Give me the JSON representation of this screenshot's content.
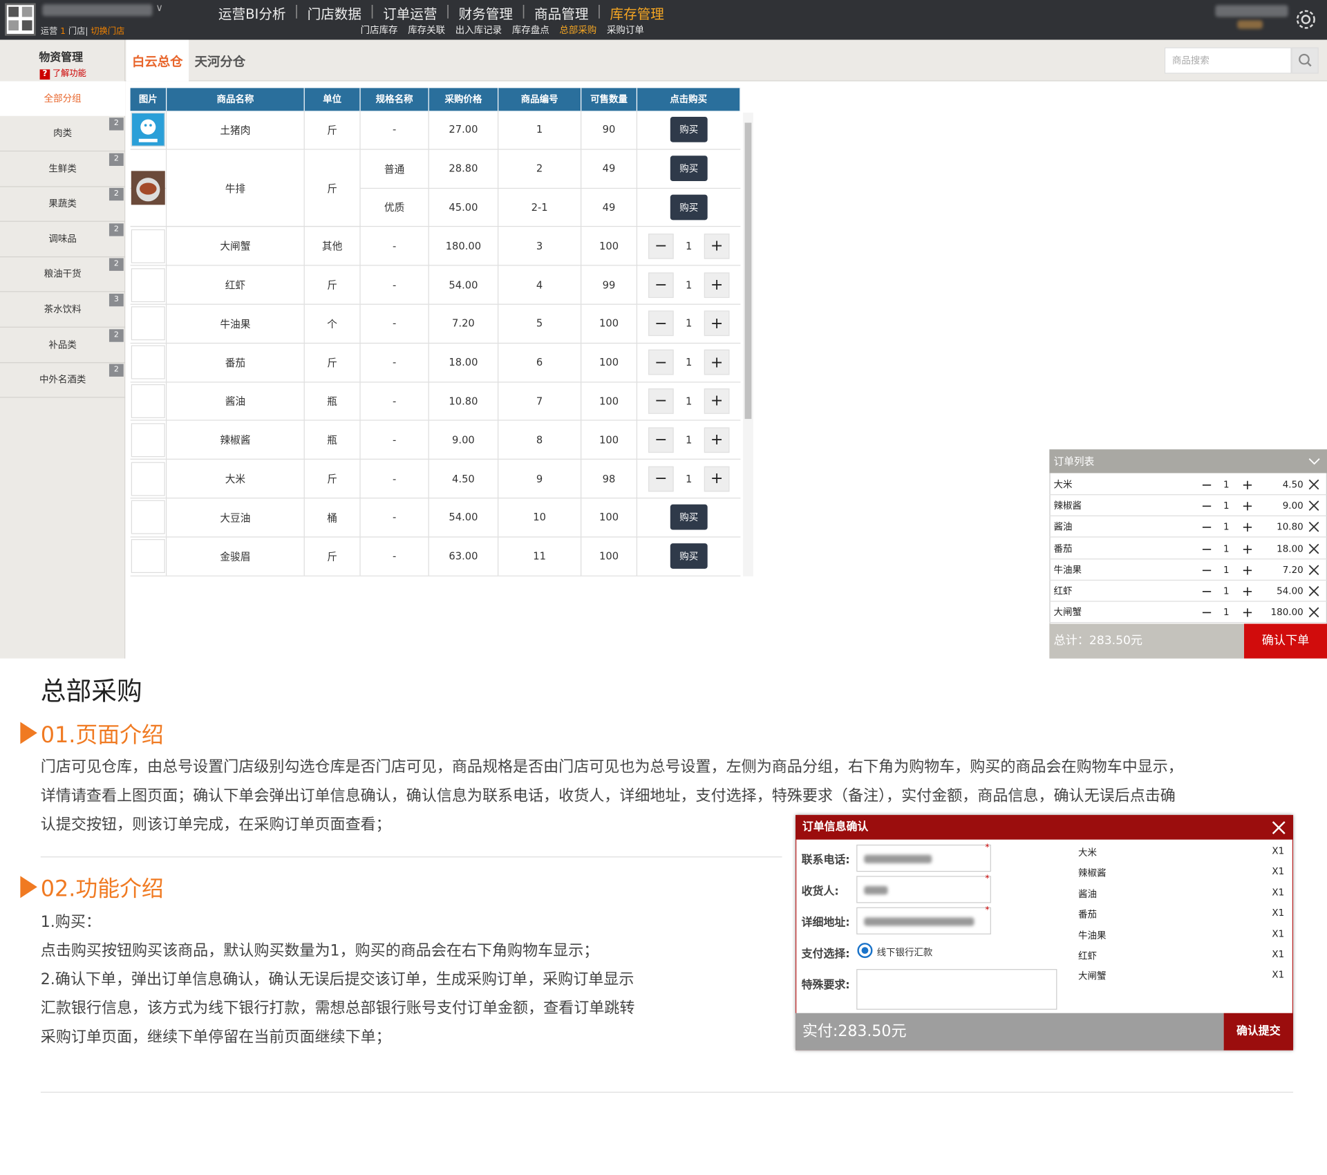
{
  "store": {
    "label_ops": "运营",
    "count": "1",
    "label_store": "门店",
    "switch": "切换门店"
  },
  "nav": {
    "main": [
      "运营BI分析",
      "门店数据",
      "订单运营",
      "财务管理",
      "商品管理",
      "库存管理"
    ],
    "sub": [
      "门店库存",
      "库存关联",
      "出入库记录",
      "库存盘点",
      "总部采购",
      "采购订单"
    ]
  },
  "header2": {
    "title": "物资管理",
    "help": "了解功能",
    "tab1": "白云总仓",
    "tab2": "天河分仓",
    "search_placeholder": "商品搜索"
  },
  "sidebar": {
    "all": "全部分组",
    "items": [
      {
        "label": "肉类",
        "count": "2"
      },
      {
        "label": "生鲜类",
        "count": "2"
      },
      {
        "label": "果蔬类",
        "count": "2"
      },
      {
        "label": "调味品",
        "count": "2"
      },
      {
        "label": "粮油干货",
        "count": "2"
      },
      {
        "label": "茶水饮料",
        "count": "3"
      },
      {
        "label": "补品类",
        "count": "2"
      },
      {
        "label": "中外名酒类",
        "count": "2"
      }
    ]
  },
  "table": {
    "headers": [
      "图片",
      "商品名称",
      "单位",
      "规格名称",
      "采购价格",
      "商品编号",
      "可售数量",
      "点击购买"
    ],
    "buy_label": "购买",
    "rows": [
      {
        "name": "土猪肉",
        "unit": "斤",
        "spec": "-",
        "price": "27.00",
        "code": "1",
        "stock": "90",
        "action": "buy"
      },
      {
        "name": "牛排",
        "unit": "斤",
        "spec": "普通",
        "price": "28.80",
        "code": "2",
        "stock": "49",
        "action": "buy"
      },
      {
        "name": "牛排",
        "unit": "斤",
        "spec": "优质",
        "price": "45.00",
        "code": "2-1",
        "stock": "49",
        "action": "buy"
      },
      {
        "name": "大闸蟹",
        "unit": "其他",
        "spec": "-",
        "price": "180.00",
        "code": "3",
        "stock": "100",
        "action": "qty",
        "qty": "1"
      },
      {
        "name": "红虾",
        "unit": "斤",
        "spec": "-",
        "price": "54.00",
        "code": "4",
        "stock": "99",
        "action": "qty",
        "qty": "1"
      },
      {
        "name": "牛油果",
        "unit": "个",
        "spec": "-",
        "price": "7.20",
        "code": "5",
        "stock": "100",
        "action": "qty",
        "qty": "1"
      },
      {
        "name": "番茄",
        "unit": "斤",
        "spec": "-",
        "price": "18.00",
        "code": "6",
        "stock": "100",
        "action": "qty",
        "qty": "1"
      },
      {
        "name": "酱油",
        "unit": "瓶",
        "spec": "-",
        "price": "10.80",
        "code": "7",
        "stock": "100",
        "action": "qty",
        "qty": "1"
      },
      {
        "name": "辣椒酱",
        "unit": "瓶",
        "spec": "-",
        "price": "9.00",
        "code": "8",
        "stock": "100",
        "action": "qty",
        "qty": "1"
      },
      {
        "name": "大米",
        "unit": "斤",
        "spec": "-",
        "price": "4.50",
        "code": "9",
        "stock": "98",
        "action": "qty",
        "qty": "1"
      },
      {
        "name": "大豆油",
        "unit": "桶",
        "spec": "-",
        "price": "54.00",
        "code": "10",
        "stock": "100",
        "action": "buy"
      },
      {
        "name": "金骏眉",
        "unit": "斤",
        "spec": "-",
        "price": "63.00",
        "code": "11",
        "stock": "100",
        "action": "buy"
      }
    ]
  },
  "order_list": {
    "title": "订单列表",
    "items": [
      {
        "name": "大米",
        "qty": "1",
        "price": "4.50"
      },
      {
        "name": "辣椒酱",
        "qty": "1",
        "price": "9.00"
      },
      {
        "name": "酱油",
        "qty": "1",
        "price": "10.80"
      },
      {
        "name": "番茄",
        "qty": "1",
        "price": "18.00"
      },
      {
        "name": "牛油果",
        "qty": "1",
        "price": "7.20"
      },
      {
        "name": "红虾",
        "qty": "1",
        "price": "54.00"
      },
      {
        "name": "大闸蟹",
        "qty": "1",
        "price": "180.00"
      }
    ],
    "total": "总计：283.50元",
    "confirm": "确认下单"
  },
  "doc": {
    "title": "总部采购",
    "sec1": "01.页面介绍",
    "para1": [
      "门店可见仓库，由总号设置门店级别勾选仓库是否门店可见，商品规格是否由门店可见也为总号设置，左侧为商品分组，右下角为购物车，购买的商品会在购物车中显示，",
      "详情请查看上图页面；确认下单会弹出订单信息确认，确认信息为联系电话，收货人，详细地址，支付选择，特殊要求（备注），实付金额，商品信息，确认无误后点击确",
      "认提交按钮，则该订单完成，在采购订单页面查看；"
    ],
    "sec2": "02.功能介绍",
    "para2": [
      "1.购买：",
      "点击购买按钮购买该商品，默认购买数量为1，购买的商品会在右下角购物车显示；",
      "2.确认下单，弹出订单信息确认，确认无误后提交该订单，生成采购订单，采购订单显示",
      "汇款银行信息，该方式为线下银行打款，需想总部银行账号支付订单金额，查看订单跳转",
      "采购订单页面，继续下单停留在当前页面继续下单；"
    ]
  },
  "dialog": {
    "title": "订单信息确认",
    "phone_label": "联系电话:",
    "receiver_label": "收货人:",
    "address_label": "详细地址:",
    "pay_label": "支付选择:",
    "pay_option": "线下银行汇款",
    "remark_label": "特殊要求:",
    "items": [
      {
        "name": "大米",
        "qty": "X1"
      },
      {
        "name": "辣椒酱",
        "qty": "X1"
      },
      {
        "name": "酱油",
        "qty": "X1"
      },
      {
        "name": "番茄",
        "qty": "X1"
      },
      {
        "name": "牛油果",
        "qty": "X1"
      },
      {
        "name": "红虾",
        "qty": "X1"
      },
      {
        "name": "大闸蟹",
        "qty": "X1"
      }
    ],
    "paid": "实付:283.50元",
    "submit": "确认提交"
  },
  "colors": {
    "topbar": "#303236",
    "accent": "#f07a22",
    "table_head": "#2a6f9c",
    "danger": "#d10c0c",
    "dialog_head": "#9b0d0d"
  }
}
